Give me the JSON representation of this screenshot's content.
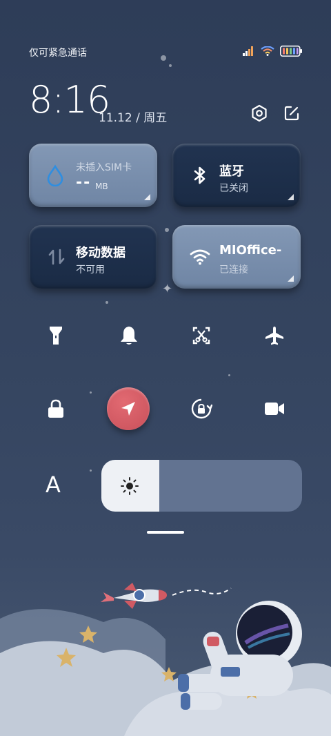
{
  "status_bar": {
    "carrier_text": "仅可紧急通话",
    "icons": [
      "signal-icon",
      "wifi-icon",
      "battery-icon"
    ]
  },
  "header": {
    "time": "8:16",
    "date": "11.12 / 周五",
    "icons": [
      "settings-hexagon-icon",
      "edit-icon"
    ]
  },
  "tiles": {
    "data_usage": {
      "title": "未插入SIM卡",
      "value": "--",
      "unit": "MB"
    },
    "bluetooth": {
      "title": "蓝牙",
      "subtitle": "已关闭"
    },
    "mobile_data": {
      "title": "移动数据",
      "subtitle": "不可用"
    },
    "wifi": {
      "title": "MIOffice-",
      "subtitle": "已连接"
    }
  },
  "toggles_row1": [
    "flashlight-icon",
    "bell-icon",
    "screenshot-icon",
    "airplane-icon"
  ],
  "toggles_row2": [
    "lock-icon",
    "location-icon",
    "rotation-lock-icon",
    "screen-record-icon"
  ],
  "brightness": {
    "level": 0.29,
    "auto_label": "A"
  },
  "colors": {
    "accent_location": "#d75b64",
    "tile_light": "#7a8fad",
    "tile_dark": "#1d2e48"
  }
}
